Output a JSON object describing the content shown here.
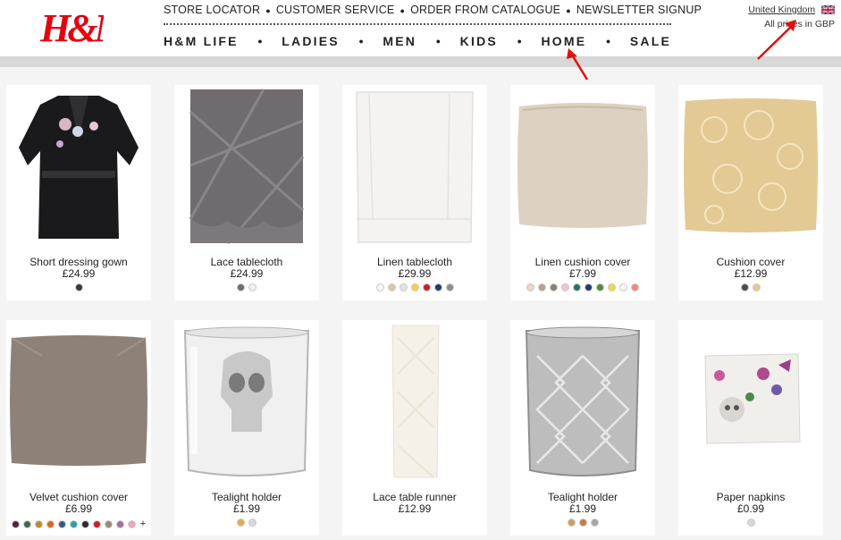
{
  "brand": {
    "logo_text": "H&M",
    "color": "#e50010"
  },
  "utility_nav": [
    {
      "label": "STORE LOCATOR"
    },
    {
      "label": "CUSTOMER SERVICE"
    },
    {
      "label": "ORDER FROM CATALOGUE"
    },
    {
      "label": "NEWSLETTER SIGNUP"
    }
  ],
  "main_nav": [
    {
      "label": "H&M LIFE"
    },
    {
      "label": "LADIES"
    },
    {
      "label": "MEN"
    },
    {
      "label": "KIDS"
    },
    {
      "label": "HOME"
    },
    {
      "label": "SALE"
    }
  ],
  "country": {
    "name": "United Kingdom",
    "flag": "uk-flag-icon",
    "prices_note": "All prices in GBP"
  },
  "annotation_color": "#e01010",
  "products": [
    {
      "name": "Short dressing gown",
      "price": "£24.99",
      "image": "dressing-gown",
      "swatches": [
        "#3a3a3a"
      ]
    },
    {
      "name": "Lace tablecloth",
      "price": "£24.99",
      "image": "lace-tablecloth",
      "swatches": [
        "#6f6b6e",
        "#f3eee8"
      ]
    },
    {
      "name": "Linen tablecloth",
      "price": "£29.99",
      "image": "linen-tablecloth",
      "swatches": [
        "#f7f5f0",
        "#d8c8ae",
        "#dde4e6",
        "#f1d34a",
        "#c81d2c",
        "#1f3b73",
        "#8b8f94"
      ]
    },
    {
      "name": "Linen cushion cover",
      "price": "£7.99",
      "image": "linen-cushion",
      "swatches": [
        "#e4d8c8",
        "#b79f8b",
        "#8a7d73",
        "#f1c6c9",
        "#2f6f5e",
        "#203a72",
        "#4f8c3f",
        "#f2da45",
        "#f8f6f1",
        "#f08a7a"
      ]
    },
    {
      "name": "Cushion cover",
      "price": "£12.99",
      "image": "gold-lace-cushion",
      "swatches": [
        "#4b4b4b",
        "#e2c98f"
      ]
    },
    {
      "name": "Velvet cushion cover",
      "price": "£6.99",
      "image": "velvet-cushion",
      "swatches": [
        "#4a2440",
        "#3e6b49",
        "#c48a2a",
        "#d96b1c",
        "#2e5f7a",
        "#2aa3a0",
        "#2a2a2a",
        "#c81d2c",
        "#9b8a76",
        "#a3709a",
        "#e7a7b6"
      ],
      "more": "+"
    },
    {
      "name": "Tealight holder",
      "price": "£1.99",
      "image": "skull-tealight",
      "swatches": [
        "#d8b04a",
        "#d8d8d8"
      ]
    },
    {
      "name": "Lace table runner",
      "price": "£12.99",
      "image": "lace-runner",
      "swatches": []
    },
    {
      "name": "Tealight holder",
      "price": "£1.99",
      "image": "mercury-tealight",
      "swatches": [
        "#c8a35a",
        "#c87a3f",
        "#a6a6a6"
      ]
    },
    {
      "name": "Paper napkins",
      "price": "£0.99",
      "image": "skull-napkins",
      "swatches": [
        "#d8d8d8"
      ]
    }
  ]
}
